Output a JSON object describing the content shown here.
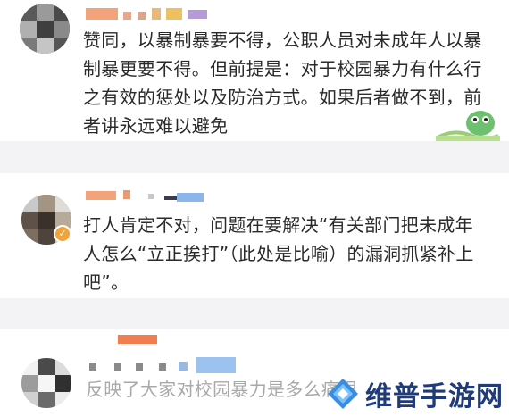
{
  "comments": [
    {
      "text": "赞同，以暴制暴要不得，公职人员对未成年人以暴制暴更要不得。但前提是：对于校园暴力有什么行之有效的惩处以及防治方式。如果后者做不到，前者讲永远难以避免"
    },
    {
      "text": "打人肯定不对，问题在要解决“有关部门把未成年人怎么“立正挨打”（此处是比喻）的漏洞抓紧补上吧”。",
      "badge_icon": "verified-badge-icon"
    },
    {
      "text": "反映了大家对校园暴力是多么痛恨"
    }
  ],
  "watermark": {
    "text": "维普手游网",
    "icon": "diamond-logo-icon"
  },
  "colors": {
    "name_orange": "#f0a070",
    "name_purple": "#9b7fd0",
    "name_blue": "#8ab6ea",
    "badge": "#f2a23a",
    "watermark": "#1f3b78"
  }
}
